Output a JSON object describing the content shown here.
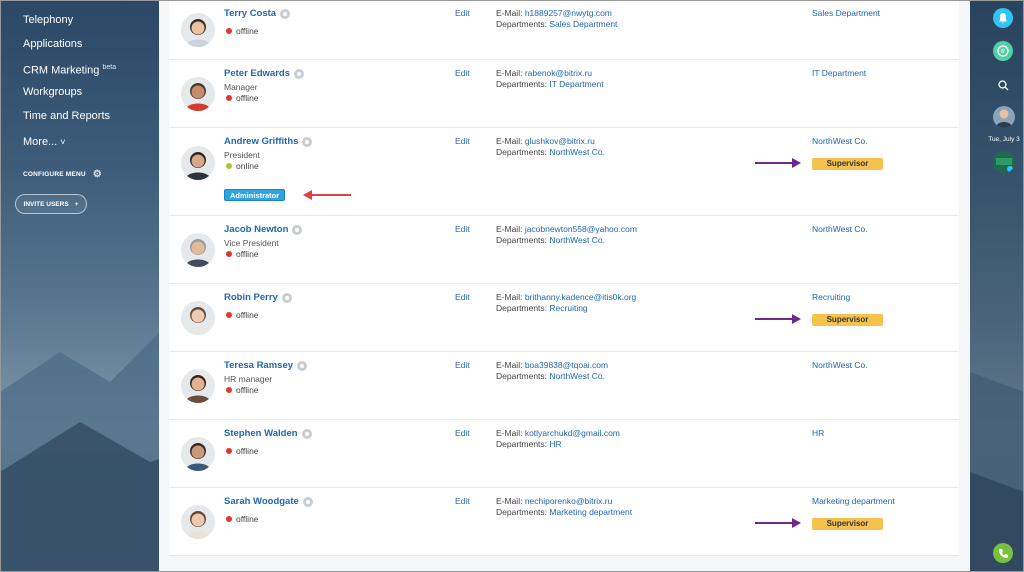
{
  "sidebar": {
    "items": [
      {
        "label": "Telephony"
      },
      {
        "label": "Applications"
      },
      {
        "label": "CRM Marketing",
        "sup": "beta"
      },
      {
        "label": "Workgroups"
      },
      {
        "label": "Time and Reports"
      },
      {
        "label": "More...",
        "caret": "˅"
      }
    ],
    "configure_label": "CONFIGURE MENU",
    "invite_label": "INVITE USERS",
    "invite_icon": "+"
  },
  "employees": [
    {
      "name": "Terry Costa",
      "position": "",
      "status": "offline",
      "edit": "Edit",
      "email_label": "E-Mail: ",
      "email": "h1889257@nwytg.com",
      "departments_label": "Departments: ",
      "department": "Sales Department",
      "dept_col": "Sales Department",
      "supervisor": ""
    },
    {
      "name": "Peter Edwards",
      "position": "Manager",
      "status": "offline",
      "edit": "Edit",
      "email_label": "E-Mail: ",
      "email": "rabenok@bitrix.ru",
      "departments_label": "Departments: ",
      "department": "IT Department",
      "dept_col": "IT Department",
      "supervisor": ""
    },
    {
      "name": "Andrew Griffiths",
      "position": "President",
      "status": "online",
      "badge": "Administrator",
      "edit": "Edit",
      "email_label": "E-Mail: ",
      "email": "glushkov@bitrix.ru",
      "departments_label": "Departments: ",
      "department": "NorthWest Co.",
      "dept_col": "NorthWest Co.",
      "supervisor": "Supervisor"
    },
    {
      "name": "Jacob Newton",
      "position": "Vice President",
      "status": "offline",
      "edit": "Edit",
      "email_label": "E-Mail: ",
      "email": "jacobnewton558@yahoo.com",
      "departments_label": "Departments: ",
      "department": "NorthWest Co.",
      "dept_col": "NorthWest Co.",
      "supervisor": ""
    },
    {
      "name": "Robin Perry",
      "position": "",
      "status": "offline",
      "edit": "Edit",
      "email_label": "E-Mail: ",
      "email": "brithanny.kadence@itis0k.org",
      "departments_label": "Departments: ",
      "department": "Recruiting",
      "dept_col": "Recruiting",
      "supervisor": "Supervisor"
    },
    {
      "name": "Teresa Ramsey",
      "position": "HR manager",
      "status": "offline",
      "edit": "Edit",
      "email_label": "E-Mail: ",
      "email": "boa39838@tqoai.com",
      "departments_label": "Departments: ",
      "department": "NorthWest Co.",
      "dept_col": "NorthWest Co.",
      "supervisor": ""
    },
    {
      "name": "Stephen Walden",
      "position": "",
      "status": "offline",
      "edit": "Edit",
      "email_label": "E-Mail: ",
      "email": "kotlyarchukd@gmail.com",
      "departments_label": "Departments: ",
      "department": "HR",
      "dept_col": "HR",
      "supervisor": ""
    },
    {
      "name": "Sarah Woodgate",
      "position": "",
      "status": "offline",
      "edit": "Edit",
      "email_label": "E-Mail: ",
      "email": "nechiporenko@bitrix.ru",
      "departments_label": "Departments: ",
      "department": "Marketing department",
      "dept_col": "Marketing department",
      "supervisor": "Supervisor"
    }
  ],
  "rightbar": {
    "date": "Tue, July 3"
  },
  "colors": {
    "link": "#2067b0",
    "supervisor_bg": "#f5c24e",
    "admin_badge": "#2fa4e0",
    "offline": "#e0372a",
    "online": "#9ccb2b",
    "annotation_arrow_purple": "#6b2a8c",
    "annotation_arrow_red": "#e04040"
  }
}
